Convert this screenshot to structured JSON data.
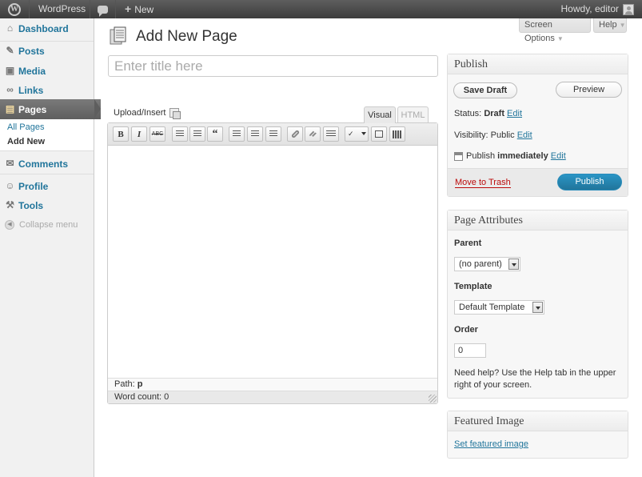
{
  "adminbar": {
    "site_name": "WordPress",
    "new_label": "New",
    "howdy": "Howdy, editor"
  },
  "menu": {
    "dashboard": "Dashboard",
    "posts": "Posts",
    "media": "Media",
    "links": "Links",
    "pages": "Pages",
    "all_pages": "All Pages",
    "add_new": "Add New",
    "comments": "Comments",
    "profile": "Profile",
    "tools": "Tools",
    "collapse": "Collapse menu"
  },
  "top_buttons": {
    "screen_options": "Screen Options",
    "help": "Help"
  },
  "page": {
    "title": "Add New Page",
    "title_placeholder": "Enter title here"
  },
  "editor": {
    "upload_insert": "Upload/Insert",
    "tab_visual": "Visual",
    "tab_html": "HTML",
    "path_label": "Path:",
    "path_value": "p",
    "word_count": "Word count: 0",
    "buttons": {
      "bold": "B",
      "italic": "I",
      "strike": "ABC",
      "quote": "“"
    }
  },
  "publish": {
    "heading": "Publish",
    "save_draft": "Save Draft",
    "preview": "Preview",
    "status_label": "Status:",
    "status_value": "Draft",
    "visibility_label": "Visibility:",
    "visibility_value": "Public",
    "publish_label": "Publish",
    "publish_when": "immediately",
    "edit": "Edit",
    "move_to_trash": "Move to Trash",
    "publish_button": "Publish"
  },
  "attributes": {
    "heading": "Page Attributes",
    "parent_label": "Parent",
    "parent_value": "(no parent)",
    "template_label": "Template",
    "template_value": "Default Template",
    "order_label": "Order",
    "order_value": "0",
    "help_text": "Need help? Use the Help tab in the upper right of your screen."
  },
  "featured": {
    "heading": "Featured Image",
    "set_link": "Set featured image"
  },
  "colors": {
    "link": "#21759b",
    "publish_button": "#21759b",
    "trash": "#bc0b0b",
    "adminbar": "#464646"
  }
}
